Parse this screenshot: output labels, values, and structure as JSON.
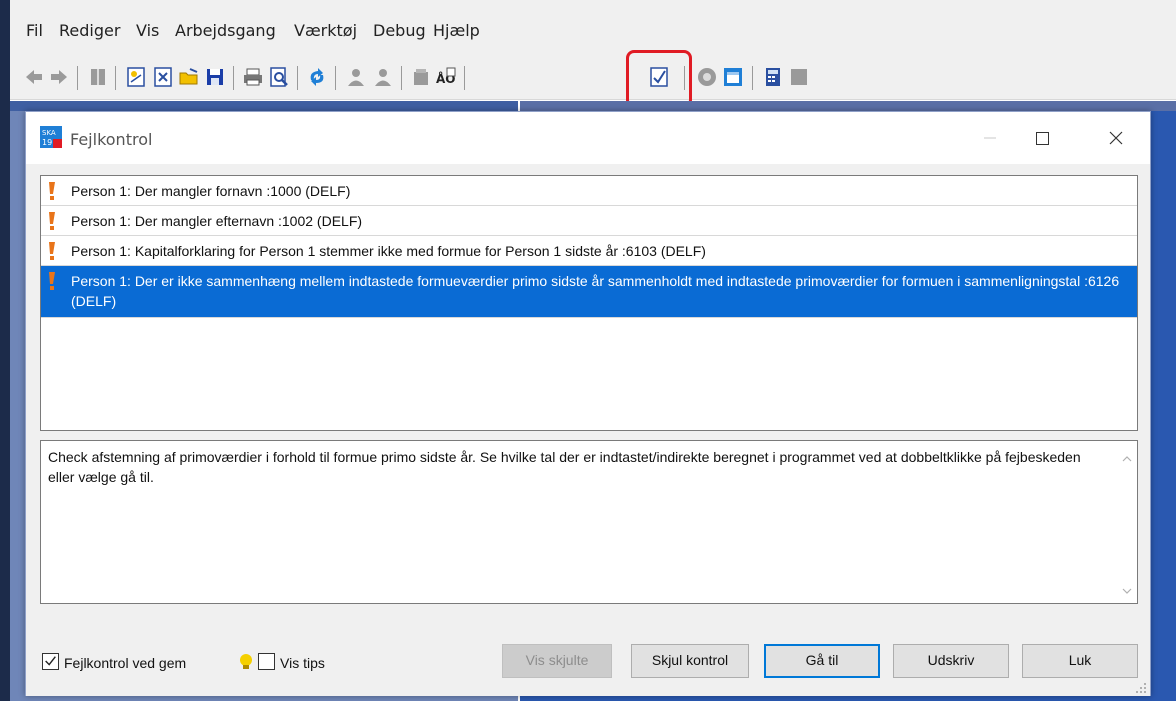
{
  "menubar": {
    "items": [
      "Fil",
      "Rediger",
      "Vis",
      "Arbejdsgang",
      "Værktøj",
      "Debug",
      "Hjælp"
    ]
  },
  "toolbar": {
    "icons": [
      "back-arrow-icon",
      "forward-arrow-icon",
      "book-icon",
      "new-document-icon",
      "close-document-icon",
      "open-folder-icon",
      "save-disk-icon",
      "print-icon",
      "print-preview-icon",
      "refresh-icon",
      "person-icon",
      "persons-icon",
      "archive-icon",
      "spellcheck-icon",
      "error-check-icon",
      "help-icon",
      "info-window-icon",
      "calculator-icon",
      "gray-block-icon"
    ],
    "highlight_color": "#e01b24"
  },
  "dialog": {
    "title": "Fejlkontrol",
    "app_icon_text": "SKA 19",
    "errors": [
      {
        "text": "Person 1: Der mangler fornavn :1000 (DELF)",
        "selected": false
      },
      {
        "text": "Person 1: Der mangler efternavn :1002 (DELF)",
        "selected": false
      },
      {
        "text": "Person 1: Kapitalforklaring for Person 1 stemmer ikke med formue for Person 1 sidste år :6103 (DELF)",
        "selected": false
      },
      {
        "text": "Person 1: Der er ikke sammenhæng mellem indtastede formueværdier primo sidste år sammenholdt med indtastede primoværdier for formuen i sammenligningstal :6126 (DELF)",
        "selected": true
      }
    ],
    "description": "Check afstemning af primoværdier i forhold til formue primo sidste år. Se hvilke tal der er indtastet/indirekte beregnet i programmet ved at dobbeltklikke på fejbeskeden eller vælge gå til.",
    "checkbox_fejlkontrol": {
      "label": "Fejlkontrol ved gem",
      "checked": true
    },
    "checkbox_tips": {
      "label": "Vis tips",
      "checked": false
    },
    "buttons": {
      "vis_skjulte": "Vis skjulte",
      "skjul_kontrol": "Skjul kontrol",
      "gaa_til": "Gå til",
      "udskriv": "Udskriv",
      "luk": "Luk"
    },
    "selection_color": "#0a6bd4"
  }
}
